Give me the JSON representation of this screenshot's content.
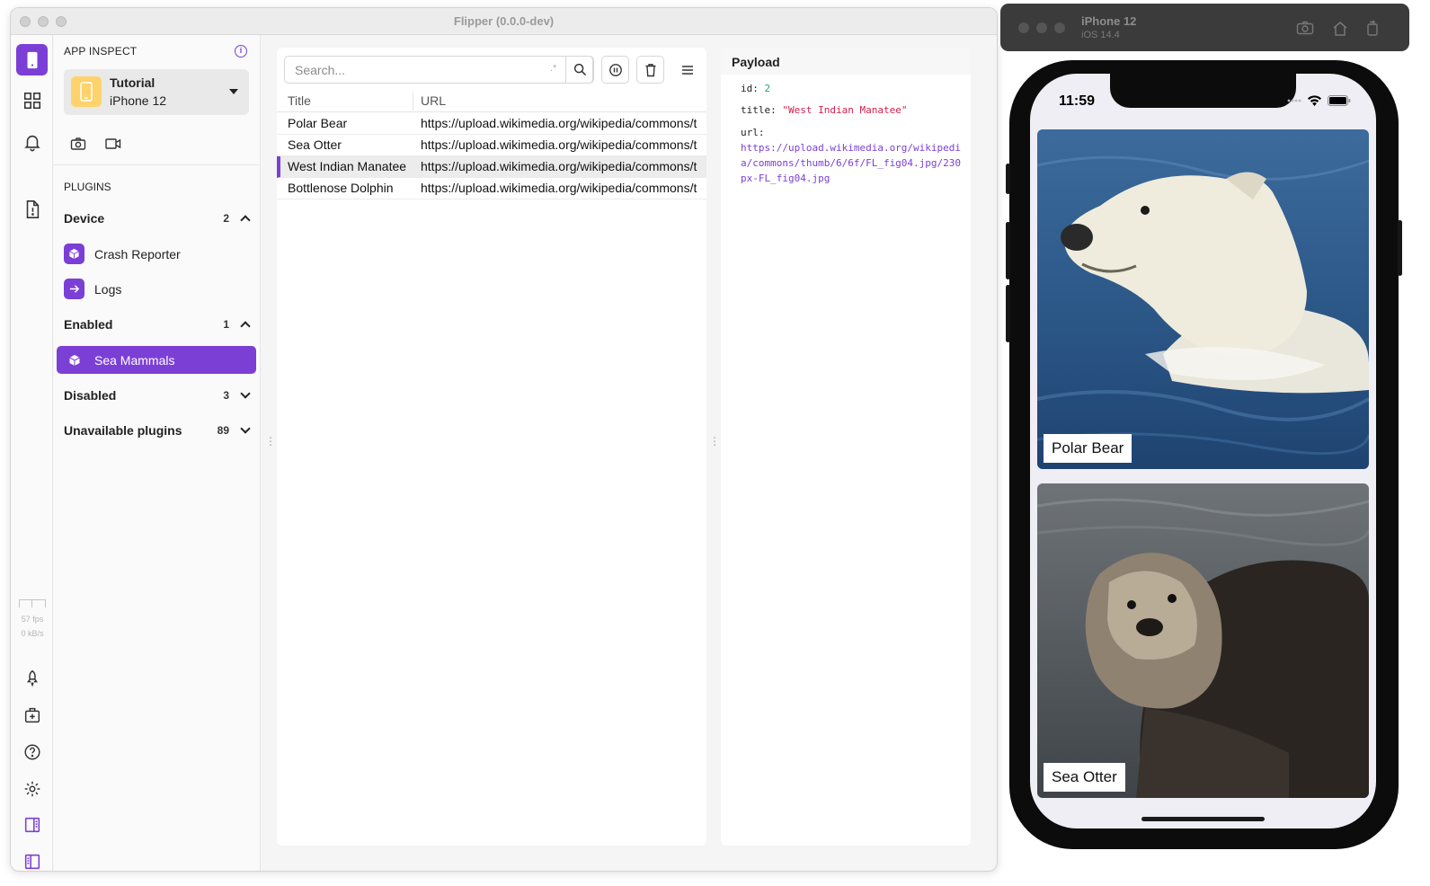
{
  "window": {
    "title": "Flipper (0.0.0-dev)"
  },
  "rail": {
    "perf_fps": "57 fps",
    "perf_kbs": "0 kB/s"
  },
  "sidebar": {
    "header": "APP INSPECT",
    "device": {
      "app": "Tutorial",
      "name": "iPhone 12"
    },
    "plugins_label": "PLUGINS",
    "groups": [
      {
        "name": "Device",
        "count": "2",
        "items": [
          "Crash Reporter",
          "Logs"
        ]
      },
      {
        "name": "Enabled",
        "count": "1",
        "items": [
          "Sea Mammals"
        ]
      },
      {
        "name": "Disabled",
        "count": "3"
      },
      {
        "name": "Unavailable plugins",
        "count": "89"
      }
    ]
  },
  "table": {
    "search_placeholder": "Search...",
    "regex_hint": ".*",
    "columns": [
      "Title",
      "URL"
    ],
    "rows": [
      {
        "title": "Polar Bear",
        "url": "https://upload.wikimedia.org/wikipedia/commons/t"
      },
      {
        "title": "Sea Otter",
        "url": "https://upload.wikimedia.org/wikipedia/commons/t"
      },
      {
        "title": "West Indian Manatee",
        "url": "https://upload.wikimedia.org/wikipedia/commons/t"
      },
      {
        "title": "Bottlenose Dolphin",
        "url": "https://upload.wikimedia.org/wikipedia/commons/t"
      }
    ],
    "selected_index": 2
  },
  "payload": {
    "title": "Payload",
    "id_key": "id",
    "id_value": "2",
    "title_key": "title",
    "title_value": "\"West Indian Manatee\"",
    "url_key": "url",
    "url_value": "https://upload.wikimedia.org/wikipedia/commons/thumb/6/6f/FL_fig04.jpg/230px-FL_fig04.jpg"
  },
  "simulator": {
    "device": "iPhone 12",
    "os": "iOS 14.4",
    "time": "11:59",
    "cards": [
      "Polar Bear",
      "Sea Otter"
    ]
  },
  "colors": {
    "accent": "#7b3fd6",
    "device_icon": "#ffd36b"
  }
}
